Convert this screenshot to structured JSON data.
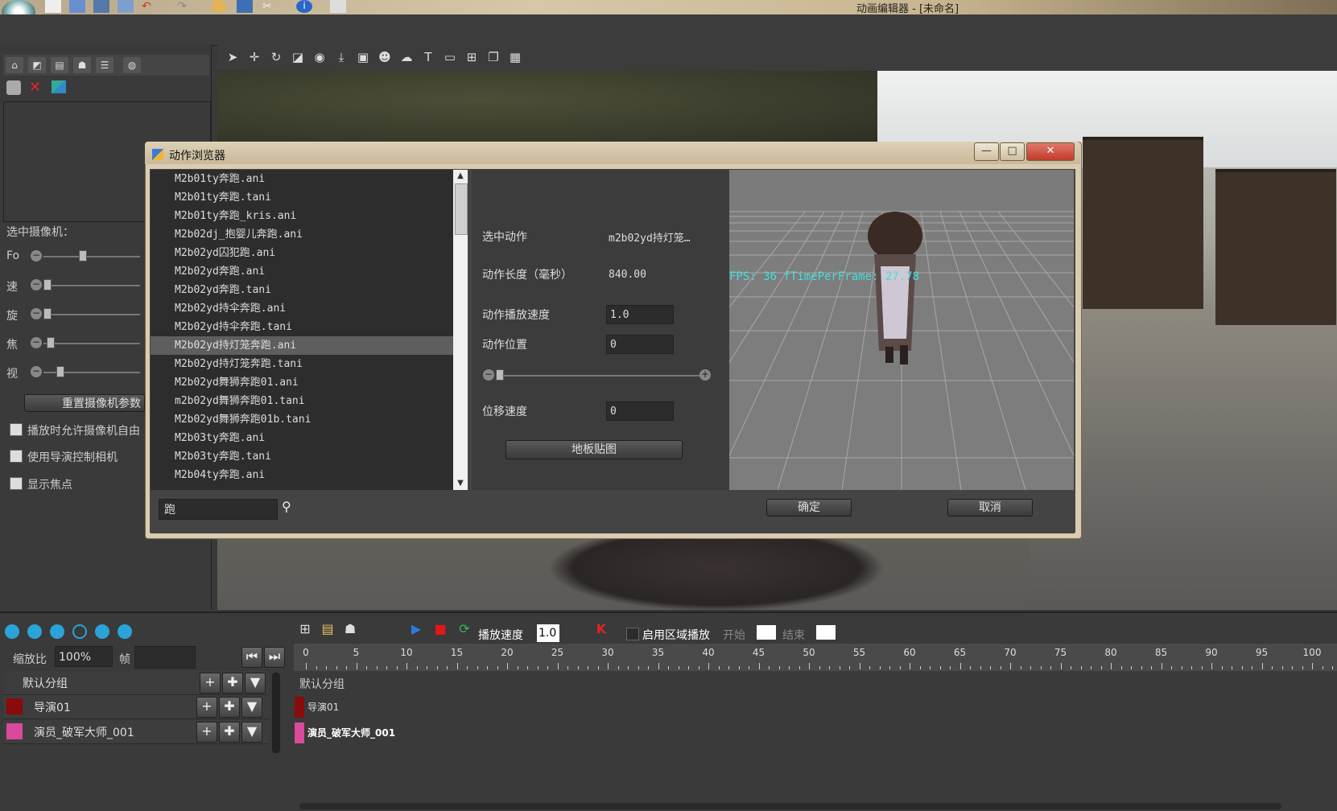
{
  "window": {
    "title": "动画编辑器 - [未命名]"
  },
  "dialog": {
    "title": "动作浏览器",
    "files": [
      "M2b01ty奔跑.ani",
      "M2b01ty奔跑.tani",
      "M2b01ty奔跑_kris.ani",
      "M2b02dj_抱婴儿奔跑.ani",
      "M2b02yd囚犯跑.ani",
      "M2b02yd奔跑.ani",
      "M2b02yd奔跑.tani",
      "M2b02yd持伞奔跑.ani",
      "M2b02yd持伞奔跑.tani",
      "M2b02yd持灯笼奔跑.ani",
      "M2b02yd持灯笼奔跑.tani",
      "M2b02yd舞狮奔跑01.ani",
      "m2b02yd舞狮奔跑01.tani",
      "M2b02yd舞狮奔跑01b.tani",
      "M2b03ty奔跑.ani",
      "M2b03ty奔跑.tani",
      "M2b04ty奔跑.ani"
    ],
    "selected_index": 9,
    "props": {
      "selected_action_label": "选中动作",
      "selected_action_value": "m2b02yd持灯笼…",
      "length_label": "动作长度（毫秒）",
      "length_value": "840.00",
      "speed_label": "动作播放速度",
      "speed_value": "1.0",
      "position_label": "动作位置",
      "position_value": "0",
      "displacement_label": "位移速度",
      "displacement_value": "0",
      "floor_texture_button": "地板贴图"
    },
    "preview": {
      "fps_text": "FPS: 36 fTimePerFrame: 27.78"
    },
    "search_value": "跑",
    "ok_button": "确定",
    "cancel_button": "取消",
    "min_glyph": "—",
    "max_glyph": "□",
    "close_glyph": "✕"
  },
  "left_panel": {
    "camera_label": "选中摄像机：",
    "sliders": [
      "Fo",
      "速",
      "旋",
      "焦",
      "视"
    ],
    "reset_button": "重置摄像机参数",
    "checkboxes": [
      "播放时允许摄像机自由",
      "使用导演控制相机",
      "显示焦点"
    ]
  },
  "timeline": {
    "zoom_label": "缩放比",
    "zoom_value": "100%",
    "frame_label": "帧",
    "play_speed_label": "播放速度",
    "play_speed_value": "1.0",
    "region_play_label": "启用区域播放",
    "start_label": "开始",
    "end_label": "结束",
    "ticks": [
      "0",
      "5",
      "10",
      "15",
      "20",
      "25",
      "30",
      "35",
      "40",
      "45",
      "50",
      "55",
      "60",
      "65",
      "70",
      "75",
      "80",
      "85",
      "90",
      "95",
      "100"
    ],
    "groups": [
      {
        "name": "默认分组",
        "color": ""
      },
      {
        "name": "导演01",
        "color": "#8b0a0a"
      },
      {
        "name": "演员_破军大师_001",
        "color": "#d94a9a"
      }
    ],
    "right_group_label": "默认分组",
    "right_tracks": [
      "导演01",
      "演员_破军大师_001"
    ]
  }
}
